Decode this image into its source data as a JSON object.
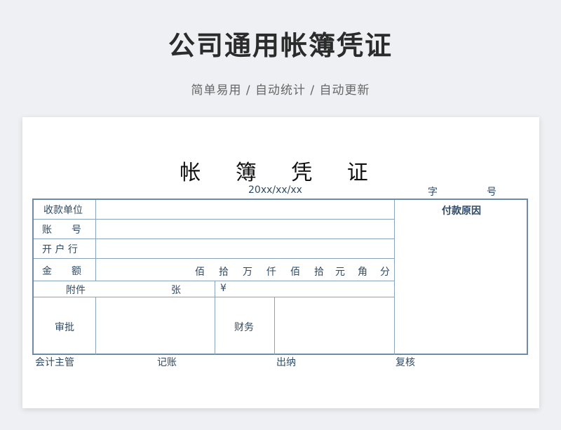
{
  "hero": {
    "title": "公司通用帐簿凭证",
    "subtitle": "简单易用 / 自动统计 / 自动更新"
  },
  "voucher": {
    "title": "帐 簿 凭 证",
    "date": "20xx/xx/xx",
    "zi": "字",
    "hao": "号",
    "payee_label": "收款单位",
    "account_label": "账　　号",
    "bank_label": "开 户 行",
    "amount_label": "金　　额",
    "amount_units": [
      "佰",
      "拾",
      "万",
      "仟",
      "佰",
      "拾",
      "元",
      "角",
      "分"
    ],
    "attachment_label": "附件",
    "sheets_label": "张",
    "currency_symbol": "¥",
    "approval_label": "审批",
    "finance_label": "财务",
    "payment_reason_label": "付款原因"
  },
  "signatures": {
    "accounting_supervisor": "会计主管",
    "bookkeeper": "记账",
    "cashier": "出纳",
    "reviewer": "复核"
  }
}
